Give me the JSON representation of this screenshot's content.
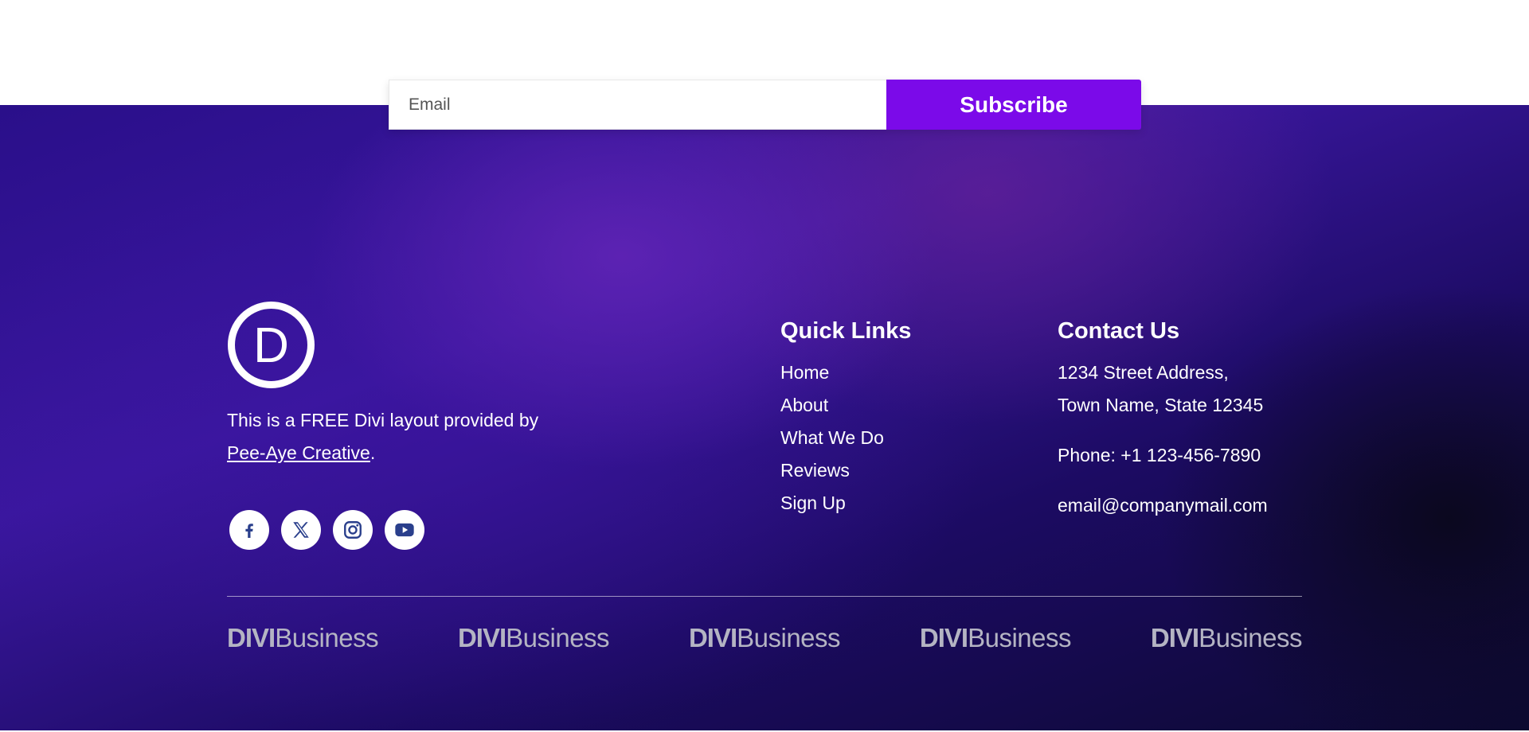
{
  "subscribe": {
    "email_placeholder": "Email",
    "button_label": "Subscribe",
    "button_color": "#7b0ae9"
  },
  "logo": {
    "letter": "D",
    "icon": "divi-logo-icon"
  },
  "about": {
    "text": "This is a FREE Divi layout provided by",
    "link_text": "Pee-Aye Creative",
    "suffix": "."
  },
  "social": [
    {
      "icon": "facebook-icon"
    },
    {
      "icon": "x-twitter-icon"
    },
    {
      "icon": "instagram-icon"
    },
    {
      "icon": "youtube-icon"
    }
  ],
  "quick_links": {
    "title": "Quick Links",
    "items": [
      "Home",
      "About",
      "What We Do",
      "Reviews",
      "Sign Up"
    ]
  },
  "contact": {
    "title": "Contact Us",
    "address_line1": "1234 Street Address,",
    "address_line2": "Town Name, State 12345",
    "phone": "Phone: +1 123-456-7890",
    "email": "email@companymail.com"
  },
  "brands": [
    {
      "bold": "DIVI",
      "regular": "Business"
    },
    {
      "bold": "DIVI",
      "regular": "Business"
    },
    {
      "bold": "DIVI",
      "regular": "Business"
    },
    {
      "bold": "DIVI",
      "regular": "Business"
    },
    {
      "bold": "DIVI",
      "regular": "Business"
    }
  ]
}
